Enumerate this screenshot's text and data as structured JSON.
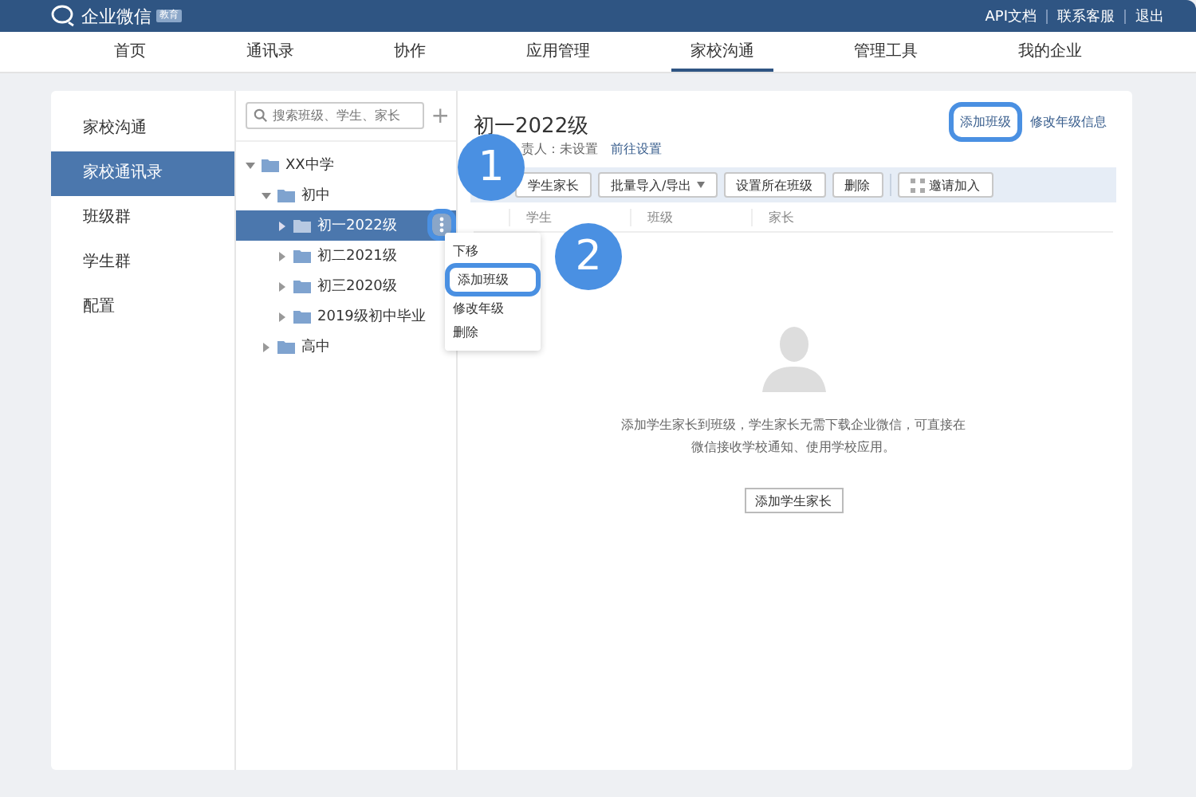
{
  "header": {
    "logo_text": "企业微信",
    "badge": "教育",
    "links": [
      "API文档",
      "联系客服",
      "退出"
    ]
  },
  "nav": [
    {
      "label": "首页",
      "selected": false
    },
    {
      "label": "通讯录",
      "selected": false
    },
    {
      "label": "协作",
      "selected": false
    },
    {
      "label": "应用管理",
      "selected": false
    },
    {
      "label": "家校沟通",
      "selected": true
    },
    {
      "label": "管理工具",
      "selected": false
    },
    {
      "label": "我的企业",
      "selected": false
    }
  ],
  "sidebar": {
    "items": [
      {
        "label": "家校沟通",
        "selected": false
      },
      {
        "label": "家校通讯录",
        "selected": true
      },
      {
        "label": "班级群",
        "selected": false
      },
      {
        "label": "学生群",
        "selected": false
      },
      {
        "label": "配置",
        "selected": false
      }
    ]
  },
  "tree": {
    "search": {
      "placeholder": "搜索班级、学生、家长"
    },
    "add": "+",
    "more_highlighted": true,
    "nodes": [
      {
        "label": "XX中学",
        "expanded": true,
        "selected": false,
        "children": [
          {
            "label": "初中",
            "expanded": true,
            "selected": false,
            "children": [
              {
                "label": "初一2022级",
                "expanded": false,
                "selected": true
              },
              {
                "label": "初二2021级",
                "expanded": false,
                "selected": false
              },
              {
                "label": "初三2020级",
                "expanded": false,
                "selected": false
              },
              {
                "label": "2019级初中毕业",
                "expanded": false,
                "selected": false
              }
            ]
          },
          {
            "label": "高中",
            "expanded": false,
            "selected": false
          }
        ]
      }
    ]
  },
  "context_menu": [
    {
      "label": "下移",
      "highlighted": false
    },
    {
      "label": "添加班级",
      "highlighted": true
    },
    {
      "label": "修改年级",
      "highlighted": false
    },
    {
      "label": "删除",
      "highlighted": false
    }
  ],
  "main": {
    "title": "初一2022级",
    "links": [
      {
        "label": "添加班级",
        "highlighted": true
      },
      {
        "label": "修改年级信息",
        "highlighted": false
      }
    ],
    "owner_label": "责人：未设置",
    "owner_link": "前往设置",
    "toolbar": [
      {
        "label": "学生家长",
        "kind": "plain"
      },
      {
        "label": "批量导入/导出",
        "kind": "dropdown"
      },
      {
        "label": "设置所在班级",
        "kind": "plain"
      },
      {
        "label": "删除",
        "kind": "plain"
      },
      {
        "label": "邀请加入",
        "kind": "icon"
      }
    ],
    "columns": [
      "学生",
      "班级",
      "家长"
    ],
    "empty_message": "添加学生家长到班级，学生家长无需下载企业微信，可直接在微信接收学校通知、使用学校应用。",
    "empty_button": "添加学生家长"
  },
  "callouts": [
    {
      "label": "1"
    },
    {
      "label": "2"
    }
  ]
}
